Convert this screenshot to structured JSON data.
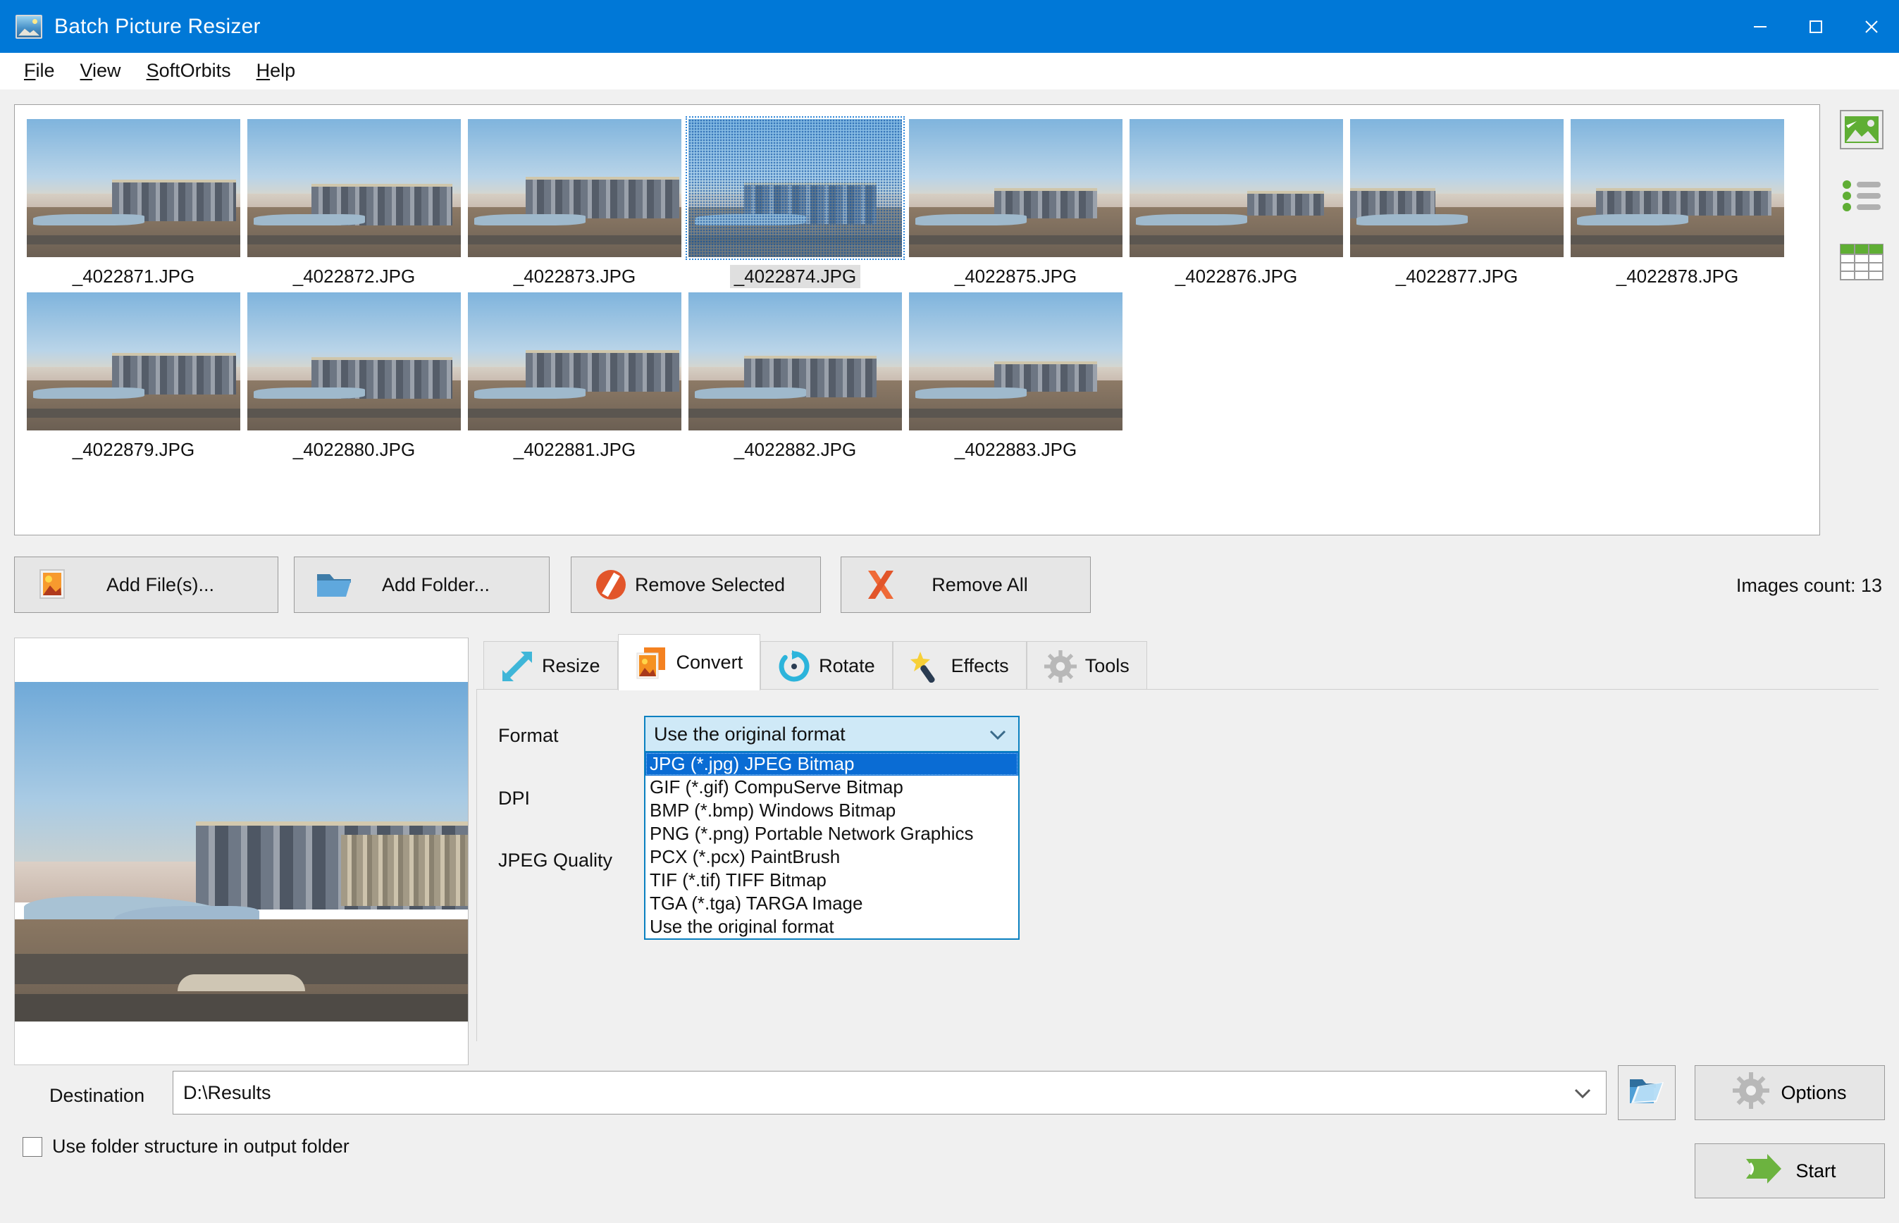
{
  "window": {
    "title": "Batch Picture Resizer",
    "app_icon": "picture-icon",
    "minimize": "—",
    "maximize": "□",
    "close": "✕"
  },
  "menu": {
    "items": [
      {
        "label": "File",
        "accel": "F"
      },
      {
        "label": "View",
        "accel": "V"
      },
      {
        "label": "SoftOrbits",
        "accel": "S"
      },
      {
        "label": "Help",
        "accel": "H"
      }
    ]
  },
  "thumbnails": {
    "items": [
      {
        "name": "_4022871.JPG",
        "selected": false
      },
      {
        "name": "_4022872.JPG",
        "selected": false
      },
      {
        "name": "_4022873.JPG",
        "selected": false
      },
      {
        "name": "_4022874.JPG",
        "selected": true
      },
      {
        "name": "_4022875.JPG",
        "selected": false
      },
      {
        "name": "_4022876.JPG",
        "selected": false
      },
      {
        "name": "_4022877.JPG",
        "selected": false
      },
      {
        "name": "_4022878.JPG",
        "selected": false
      },
      {
        "name": "_4022879.JPG",
        "selected": false
      },
      {
        "name": "_4022880.JPG",
        "selected": false
      },
      {
        "name": "_4022881.JPG",
        "selected": false
      },
      {
        "name": "_4022882.JPG",
        "selected": false
      },
      {
        "name": "_4022883.JPG",
        "selected": false
      }
    ]
  },
  "view_modes": [
    {
      "icon": "thumbnail-view-icon",
      "label": "Thumbnails"
    },
    {
      "icon": "list-view-icon",
      "label": "List"
    },
    {
      "icon": "details-view-icon",
      "label": "Details"
    }
  ],
  "actions": {
    "add_files": "Add File(s)...",
    "add_folder": "Add Folder...",
    "remove_selected": "Remove Selected",
    "remove_all": "Remove All",
    "images_count": "Images count: 13"
  },
  "tabs": [
    {
      "label": "Resize",
      "icon": "resize-arrow-icon",
      "active": false
    },
    {
      "label": "Convert",
      "icon": "convert-image-icon",
      "active": true
    },
    {
      "label": "Rotate",
      "icon": "rotate-icon",
      "active": false
    },
    {
      "label": "Effects",
      "icon": "magic-wand-icon",
      "active": false
    },
    {
      "label": "Tools",
      "icon": "gear-icon",
      "active": false
    }
  ],
  "convert_panel": {
    "format_label": "Format",
    "dpi_label": "DPI",
    "jpeg_quality_label": "JPEG Quality",
    "format_value": "Use the original format",
    "format_options": [
      {
        "label": "JPG (*.jpg) JPEG Bitmap",
        "highlighted": true
      },
      {
        "label": "GIF (*.gif) CompuServe Bitmap",
        "highlighted": false
      },
      {
        "label": "BMP (*.bmp) Windows Bitmap",
        "highlighted": false
      },
      {
        "label": "PNG (*.png) Portable Network Graphics",
        "highlighted": false
      },
      {
        "label": "PCX (*.pcx) PaintBrush",
        "highlighted": false
      },
      {
        "label": "TIF (*.tif) TIFF Bitmap",
        "highlighted": false
      },
      {
        "label": "TGA (*.tga) TARGA Image",
        "highlighted": false
      },
      {
        "label": "Use the original format",
        "highlighted": false
      }
    ]
  },
  "footer": {
    "destination_label": "Destination",
    "destination_value": "D:\\Results",
    "browse_icon": "open-folder-icon",
    "options_label": "Options",
    "start_label": "Start",
    "use_folder_structure_label": "Use folder structure in output folder",
    "use_folder_structure_checked": false
  },
  "colors": {
    "titlebar": "#0078d7",
    "accent_blue": "#0a6cd4",
    "combo_bg": "#cfe9f7",
    "window_bg": "#f0f0f0",
    "start_green": "#5cae3c"
  }
}
